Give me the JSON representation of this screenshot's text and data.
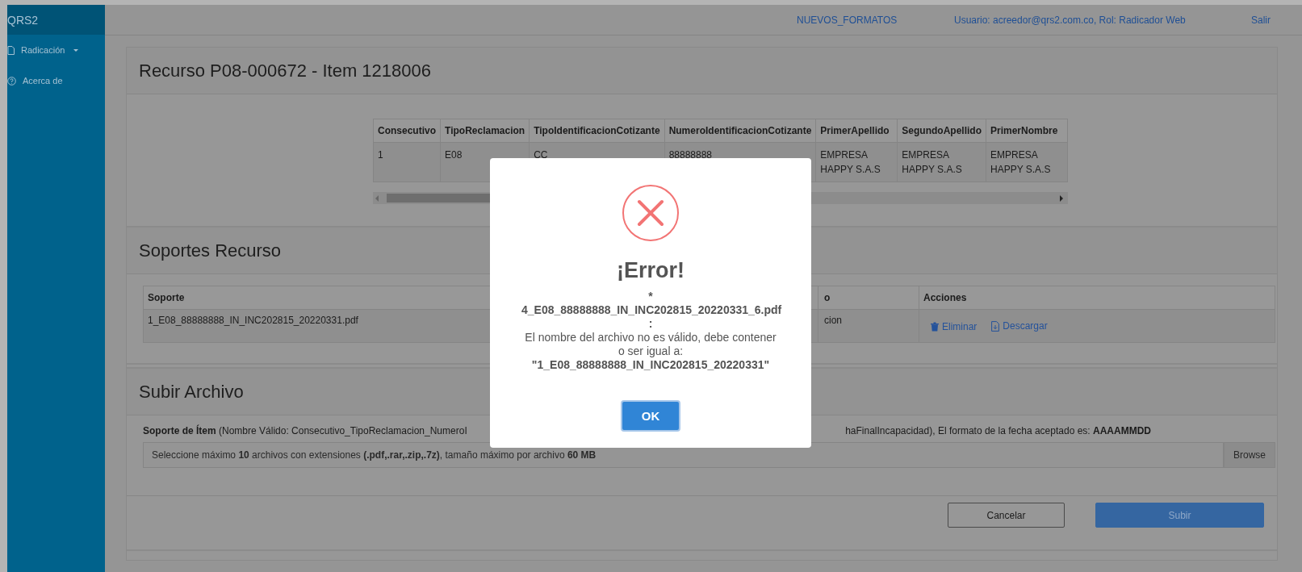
{
  "sidebar": {
    "brand": "QRS2",
    "items": [
      {
        "label": "Radicación",
        "has_dropdown": true
      },
      {
        "label": "Acerca de",
        "has_dropdown": false
      }
    ]
  },
  "topbar": {
    "links": [
      "NUEVOS_FORMATOS",
      "Usuario: acreedor@qrs2.com.co, Rol: Radicador Web",
      "Salir"
    ]
  },
  "panel": {
    "title": "Recurso P08-000672 - Item 1218006",
    "table": {
      "columns": [
        "Consecutivo",
        "TipoReclamacion",
        "TipoIdentificacionCotizante",
        "NumeroIdentificacionCotizante",
        "PrimerApellido",
        "SegundoApellido",
        "PrimerNombre"
      ],
      "rows": [
        [
          "1",
          "E08",
          "CC",
          "88888888",
          "EMPRESA HAPPY S.A.S",
          "EMPRESA HAPPY S.A.S",
          "EMPRESA HAPPY S.A.S"
        ]
      ]
    }
  },
  "soportes": {
    "title": "Soportes Recurso",
    "table": {
      "columns": [
        "Soporte",
        "o",
        "Acciones"
      ],
      "rows": [
        {
          "soporte": "1_E08_88888888_IN_INC202815_20220331.pdf",
          "column_3": "cion",
          "actions": [
            {
              "label": "Eliminar",
              "kind": "delete"
            },
            {
              "label": "Descargar",
              "kind": "download"
            }
          ]
        }
      ]
    }
  },
  "upload": {
    "title": "Subir Archivo",
    "instruction_left": "**Soporte de Ítem** (Nombre Válido: Consecutivo_TipoReclamacion_NumeroI",
    "instruction_right": "haFinalIncapacidad), El formato de la fecha aceptado es: **AAAAMMDD**",
    "file_caption": "Seleccione máximo **10** archivos con extensiones **(.pdf,.rar,.zip,.7z)**, tamaño máximo por archivo **60 MB**",
    "browse": "Browse",
    "buttons": [
      {
        "label": "Cancelar",
        "kind": "secondary"
      },
      {
        "label": "Subir",
        "kind": "primary"
      }
    ]
  },
  "modal": {
    "title": "¡Error!",
    "lines": [
      {
        "text": "*",
        "bold": true
      },
      {
        "text": "4_E08_88888888_IN_INC202815_20220331_6.pdf",
        "bold": true
      },
      {
        "text": ":",
        "bold": true
      },
      {
        "text": "El nombre del archivo no es válido, debe contener o ser igual a:",
        "bold": false
      },
      {
        "text": "\"1_E08_88888888_IN_INC202815_20220331\"",
        "bold": true
      }
    ],
    "button": "OK"
  }
}
